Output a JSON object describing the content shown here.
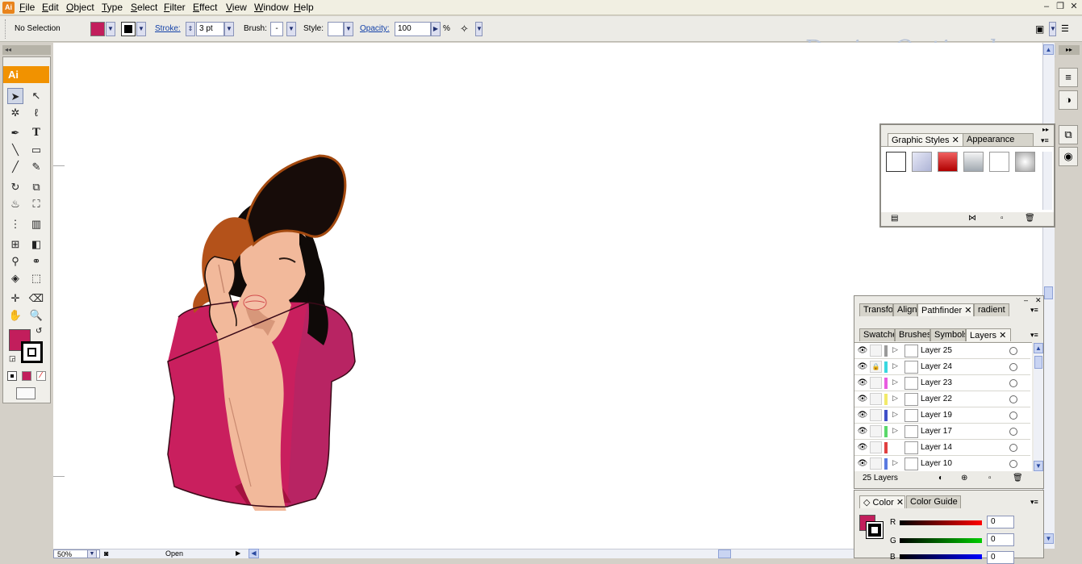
{
  "menubar": {
    "app_icon": "Ai",
    "items": [
      "File",
      "Edit",
      "Object",
      "Type",
      "Select",
      "Filter",
      "Effect",
      "View",
      "Window",
      "Help"
    ]
  },
  "control": {
    "selection_status": "No Selection",
    "fill_color": "#c21e5c",
    "stroke_color": "#000000",
    "stroke_label": "Stroke:",
    "stroke_value": "3 pt",
    "brush_label": "Brush:",
    "brush_value": "-",
    "style_label": "Style:",
    "opacity_label": "Opacity:",
    "opacity_value": "100",
    "opacity_unit": "%"
  },
  "watermark": "DesignOptimal.com",
  "tools": {
    "badge": "Ai",
    "fill_color": "#c21e5c",
    "stroke_color": "#000000"
  },
  "status": {
    "zoom": "50%",
    "status_text": "Open"
  },
  "graphic_styles_panel": {
    "tabs": [
      "Graphic Styles",
      "Appearance"
    ],
    "styles": [
      "default",
      "soft-lavender",
      "red-gradient",
      "silver-gradient",
      "white",
      "grey-gradient"
    ]
  },
  "pathfinder_panel": {
    "tabs": [
      "Transfo",
      "Align",
      "Pathfinder",
      "radient"
    ]
  },
  "layers_panel": {
    "tabs": [
      "Swatche",
      "Brushes",
      "Symbols",
      "Layers"
    ],
    "layers": [
      {
        "name": "Layer 25",
        "color": "#9a9a9a",
        "locked": false,
        "expandable": true
      },
      {
        "name": "Layer 24",
        "color": "#3ad8e0",
        "locked": true,
        "expandable": true
      },
      {
        "name": "Layer 23",
        "color": "#e85ce0",
        "locked": false,
        "expandable": true
      },
      {
        "name": "Layer 22",
        "color": "#f2ea6a",
        "locked": false,
        "expandable": true
      },
      {
        "name": "Layer 19",
        "color": "#4050c8",
        "locked": false,
        "expandable": true
      },
      {
        "name": "Layer 17",
        "color": "#5ad86a",
        "locked": false,
        "expandable": true
      },
      {
        "name": "Layer 14",
        "color": "#e04040",
        "locked": false,
        "expandable": false
      },
      {
        "name": "Layer 10",
        "color": "#5a7ae0",
        "locked": false,
        "expandable": true
      }
    ],
    "count_label": "25 Layers"
  },
  "color_panel": {
    "tabs": [
      "Color",
      "Color Guide"
    ],
    "fill_color": "#c21e5c",
    "r_label": "R",
    "g_label": "G",
    "b_label": "B",
    "r_value": "0",
    "g_value": "0",
    "b_value": "0"
  }
}
